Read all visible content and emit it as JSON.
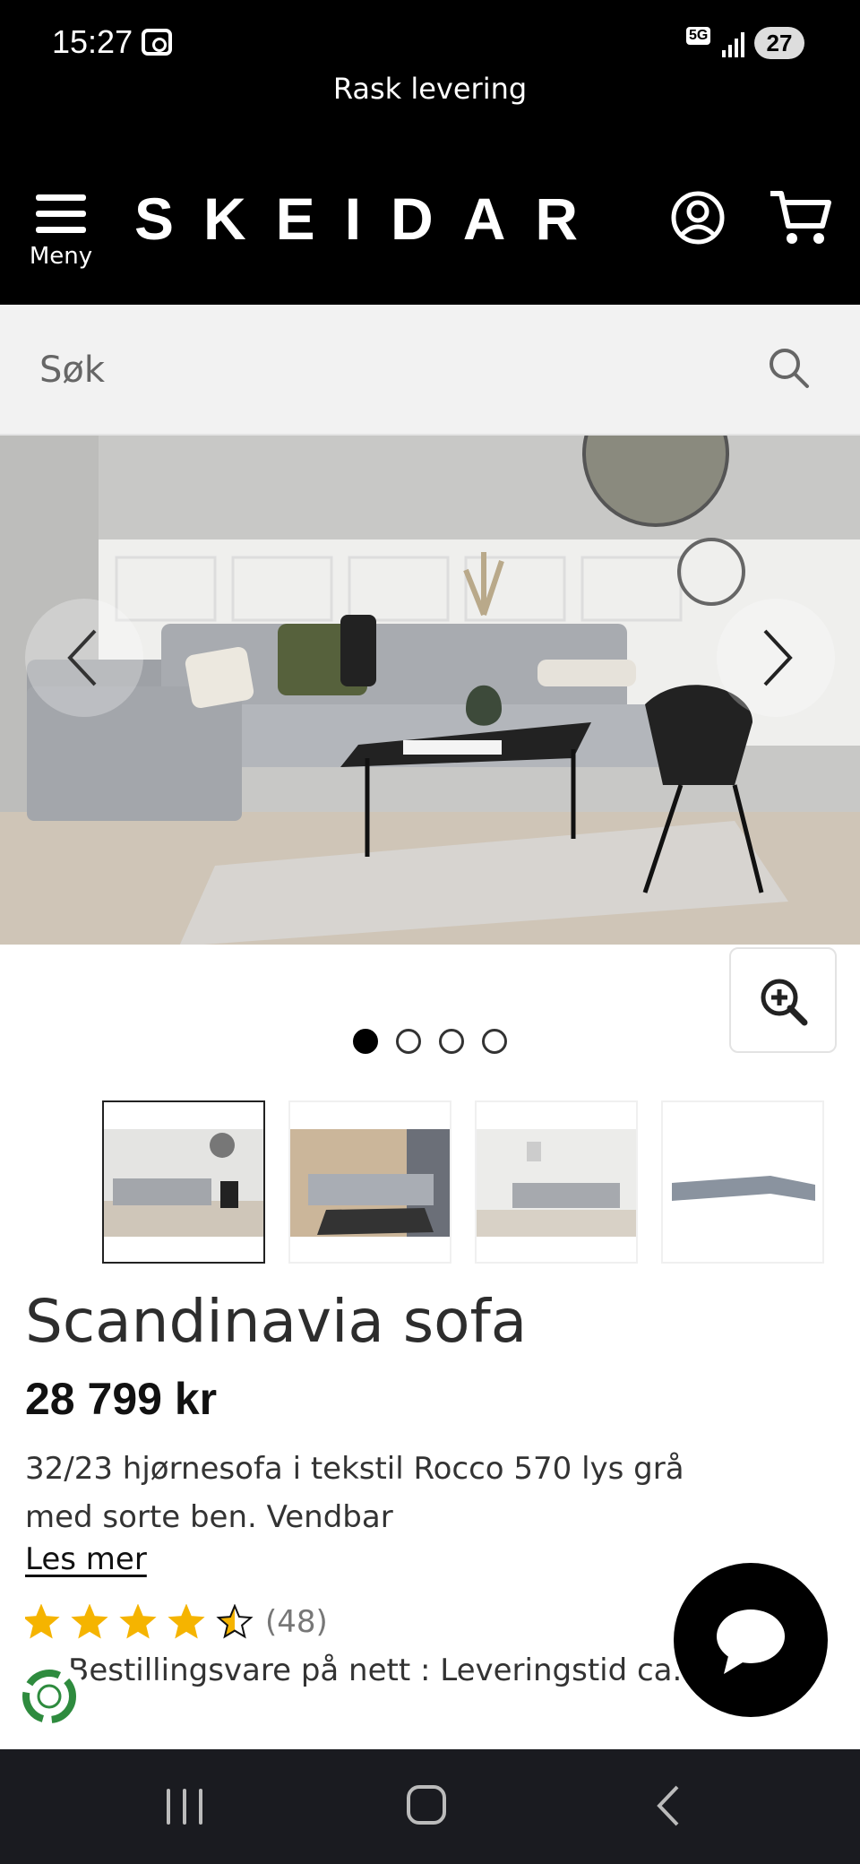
{
  "status_bar": {
    "time": "15:27",
    "network": "5G",
    "battery": "27"
  },
  "promo": {
    "text": "Rask levering"
  },
  "header": {
    "menu_label": "Meny",
    "logo": "SKEIDAR"
  },
  "search": {
    "placeholder": "Søk"
  },
  "gallery": {
    "slide_count": 4,
    "active_slide": 1,
    "thumbnails": [
      "sofa-living-room-1",
      "sofa-living-room-2",
      "sofa-living-room-3",
      "sofa-product-shot"
    ]
  },
  "product": {
    "title": "Scandinavia sofa",
    "price": "28 799 kr",
    "description": "32/23 hjørnesofa i tekstil Rocco 570 lys grå med sorte ben. Vendbar",
    "read_more": "Les mer",
    "rating_value": 4.5,
    "rating_max": 5,
    "rating_count": "(48)",
    "delivery": "Bestillingsvare på nett : Leveringstid ca. 5"
  },
  "colors": {
    "header_bg": "#000000",
    "star": "#f5b400",
    "search_bg": "#f2f2f2",
    "nav_bg": "#1a1b20",
    "eco_green": "#2e8b3e"
  },
  "icons": {
    "menu": "hamburger-icon",
    "account": "user-circle-icon",
    "cart": "shopping-cart-icon",
    "search": "magnifier-icon",
    "zoom": "zoom-in-icon",
    "chat": "chat-bubble-icon",
    "eco": "recycle-icon"
  }
}
